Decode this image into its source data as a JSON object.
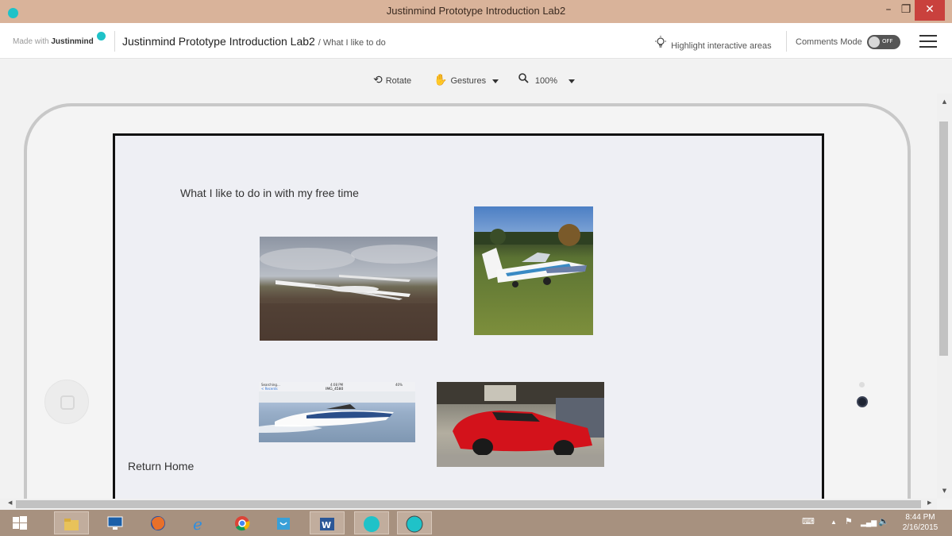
{
  "window": {
    "title": "Justinmind Prototype Introduction Lab2",
    "minimize_glyph": "–",
    "restore_glyph": "❐",
    "close_glyph": "✕"
  },
  "header": {
    "made_with": "Made with",
    "brand": "Justinmind",
    "project_title": "Justinmind Prototype Introduction Lab2",
    "page_path": "/ What I like to do",
    "highlight_label": "Highlight interactive areas",
    "comments_label": "Comments Mode",
    "comments_state": "OFF"
  },
  "toolbar": {
    "rotate_label": "Rotate",
    "gestures_label": "Gestures",
    "zoom_value": "100%"
  },
  "screen": {
    "heading": "What I like to do in with my free time",
    "return_link": "Return Home",
    "images": [
      "gliders-photo",
      "small-plane-photo",
      "speedboat-photo",
      "red-sports-car-photo"
    ],
    "boat_status_bar": {
      "left": "Searching...",
      "back": "< Recents",
      "time": "4:08 PM",
      "filename": "IMG_4580",
      "battery": "40%"
    }
  },
  "taskbar": {
    "apps": [
      "start",
      "file-explorer",
      "lenovo",
      "firefox",
      "internet-explorer",
      "chrome",
      "store",
      "word",
      "justinmind",
      "justinmind-active"
    ],
    "time": "8:44 PM",
    "date": "2/16/2015"
  },
  "colors": {
    "titlebar": "#d9b39a",
    "accent": "#1fc2c8",
    "close": "#c9413d",
    "taskbar": "#a7917f"
  }
}
